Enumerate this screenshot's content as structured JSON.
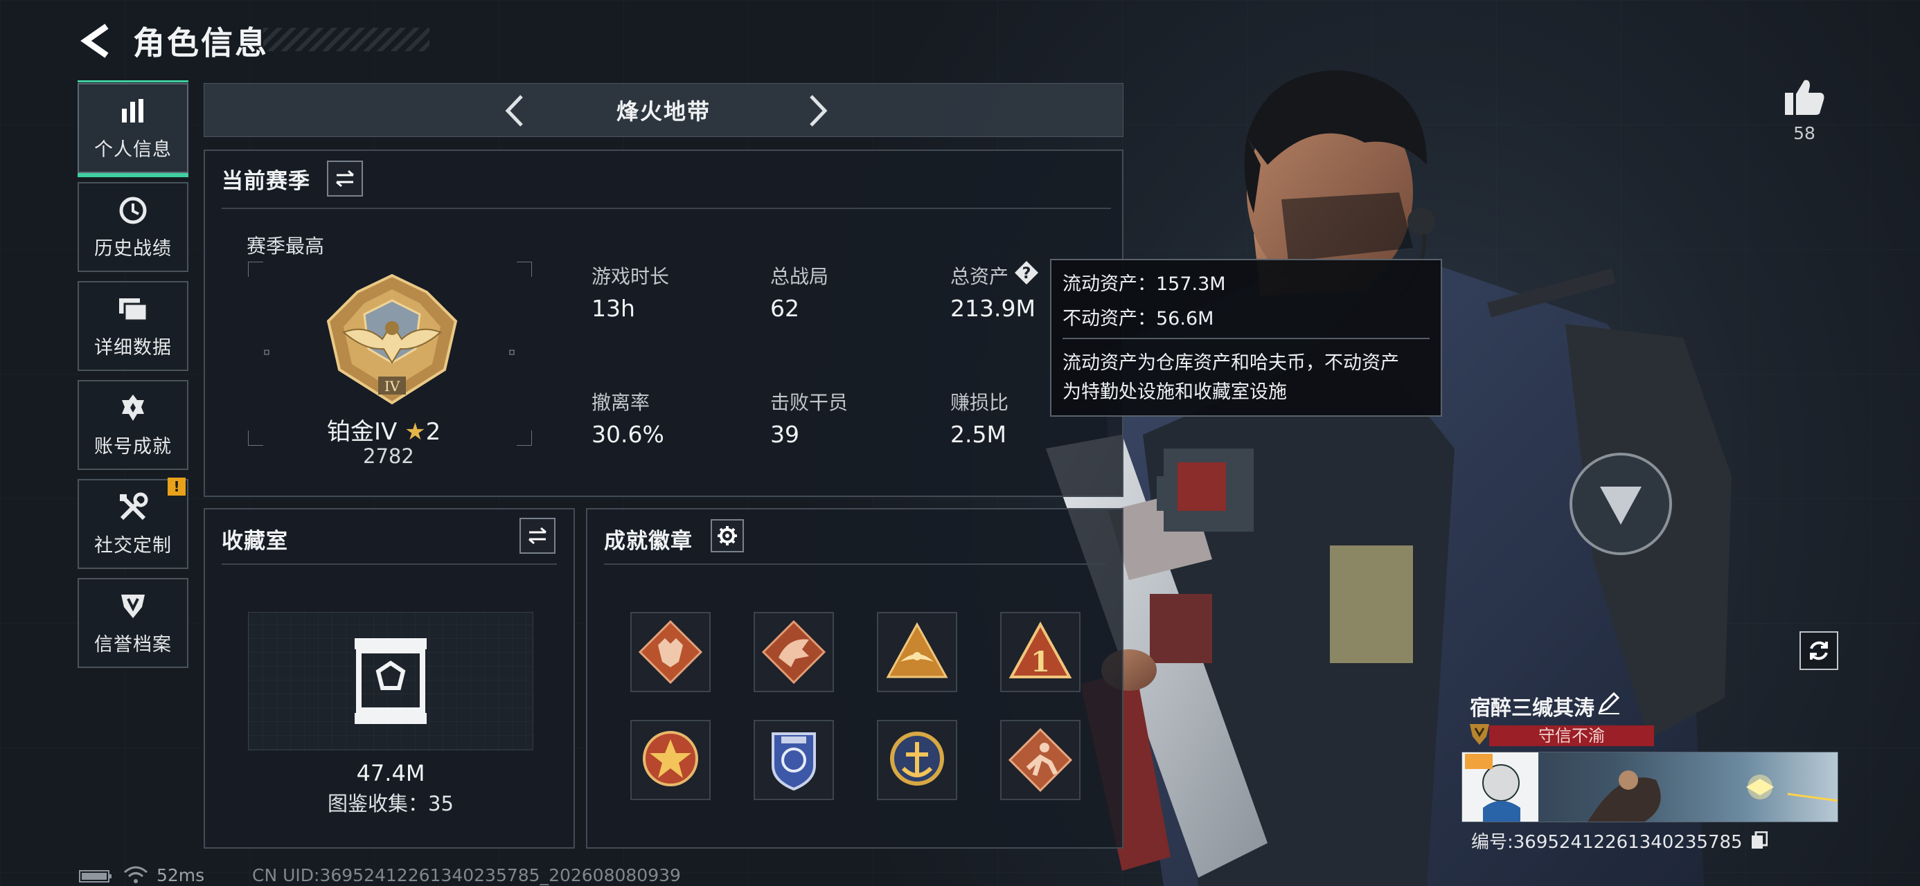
{
  "header": {
    "title": "角色信息"
  },
  "nav": {
    "items": [
      {
        "label": "个人信息",
        "icon": "bar-chart-icon",
        "active": true
      },
      {
        "label": "历史战绩",
        "icon": "clock-icon"
      },
      {
        "label": "详细数据",
        "icon": "folder-icon"
      },
      {
        "label": "账号成就",
        "icon": "achievement-icon"
      },
      {
        "label": "社交定制",
        "icon": "tools-icon",
        "badge": "!"
      },
      {
        "label": "信誉档案",
        "icon": "credit-shield-icon"
      }
    ]
  },
  "mode": {
    "label": "烽火地带"
  },
  "season": {
    "title": "当前赛季",
    "best_label": "赛季最高",
    "rank_name": "铂金IV",
    "rank_star": "2",
    "rank_score": "2782",
    "rank_emblem_text": "IV",
    "stats": [
      {
        "label": "游戏时长",
        "value": "13h"
      },
      {
        "label": "总战局",
        "value": "62"
      },
      {
        "label": "总资产",
        "value": "213.9M",
        "has_help": true
      },
      {
        "label": "撤离率",
        "value": "30.6%"
      },
      {
        "label": "击败干员",
        "value": "39"
      },
      {
        "label": "赚损比",
        "value": "2.5M"
      }
    ]
  },
  "tooltip": {
    "line1": "流动资产：157.3M",
    "line2": "不动资产：56.6M",
    "desc1": "流动资产为仓库资产和哈夫币，不动资产",
    "desc2": "为特勤处设施和收藏室设施"
  },
  "collection": {
    "title": "收藏室",
    "value": "47.4M",
    "subtitle": "图鉴收集：35"
  },
  "badges": {
    "title": "成就徽章",
    "items": [
      {
        "name": "wolf-badge",
        "color": "#b8532e"
      },
      {
        "name": "dragon-badge",
        "color": "#a7492b"
      },
      {
        "name": "wing-badge",
        "color": "#c9862e"
      },
      {
        "name": "number-one-badge",
        "color": "#c98a2c"
      },
      {
        "name": "star-medal-badge",
        "color": "#b7472d"
      },
      {
        "name": "police-badge",
        "color": "#3e58a8"
      },
      {
        "name": "anchor-medal-badge",
        "color": "#b58a2c"
      },
      {
        "name": "runner-badge",
        "color": "#b45a36"
      }
    ]
  },
  "profile": {
    "likes": "58",
    "player_name": "宿醉三缄其涛",
    "honor": "守信不渝",
    "card_id": "编号:3695241226134023578⁠​5"
  },
  "footer": {
    "ping": "52ms",
    "uid": "CN UID:3695241226134023578 5_202608080939"
  },
  "colors": {
    "accent": "#3fd0a0",
    "warning": "#e8a11a",
    "honor_red": "#9a1f26",
    "panel_border": "#434b55"
  }
}
